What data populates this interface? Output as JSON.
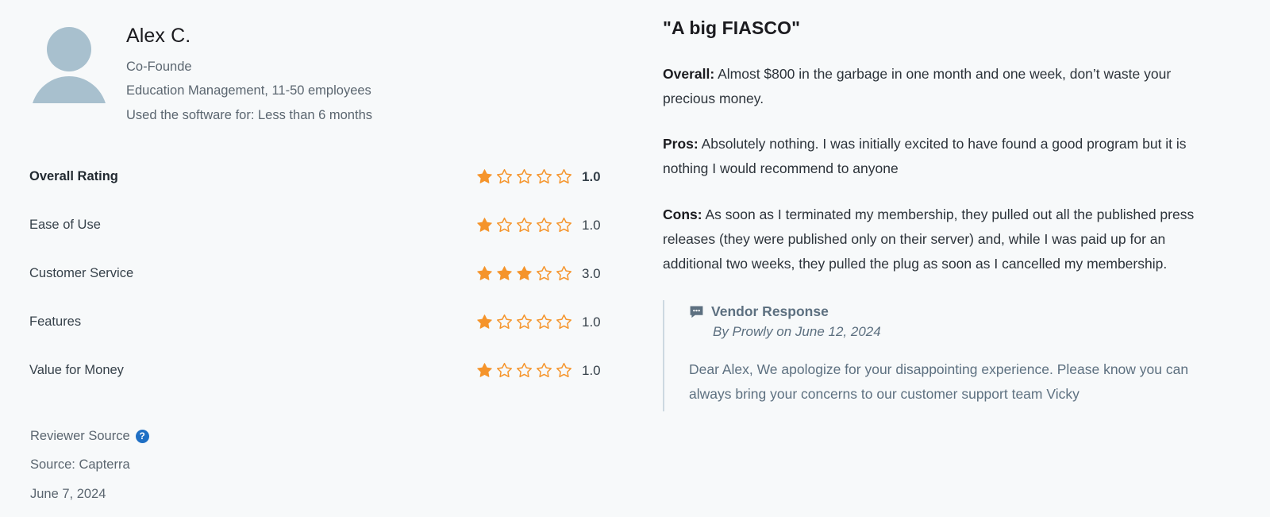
{
  "reviewer": {
    "name": "Alex C.",
    "avatar_icon": "user-avatar-placeholder-icon",
    "job_title": "Co-Founde",
    "industry_line": "Education Management, 11-50 employees",
    "usage_line": "Used the software for: Less than 6 months"
  },
  "ratings": {
    "rows": [
      {
        "label": "Overall Rating",
        "value": "1.0",
        "stars": 1,
        "max": 5,
        "primary": true
      },
      {
        "label": "Ease of Use",
        "value": "1.0",
        "stars": 1,
        "max": 5,
        "primary": false
      },
      {
        "label": "Customer Service",
        "value": "3.0",
        "stars": 3,
        "max": 5,
        "primary": false
      },
      {
        "label": "Features",
        "value": "1.0",
        "stars": 1,
        "max": 5,
        "primary": false
      },
      {
        "label": "Value for Money",
        "value": "1.0",
        "stars": 1,
        "max": 5,
        "primary": false
      }
    ],
    "star_filled_color": "#f5942b",
    "star_empty_color": "#f5942b"
  },
  "source": {
    "reviewer_source_label": "Reviewer Source",
    "help_icon": "help-question-icon",
    "help_icon_glyph": "?",
    "help_icon_color": "#1f6fc4",
    "source_label": "Source: Capterra",
    "review_date": "June 7, 2024"
  },
  "review": {
    "title": "\"A big FIASCO\"",
    "overall_label": "Overall:",
    "overall_text": " Almost $800 in the garbage in one month and one week, don’t waste your precious money.",
    "pros_label": "Pros:",
    "pros_text": " Absolutely nothing. I was initially excited to have found a good program but it is nothing I would recommend to anyone",
    "cons_label": "Cons:",
    "cons_text": " As soon as I terminated my membership, they pulled out all the published press releases (they were published only on their server) and, while I was paid up for an additional two weeks, they pulled the plug as soon as I cancelled my membership."
  },
  "vendor_response": {
    "icon": "chat-bubble-icon",
    "title": "Vendor Response",
    "byline": "By Prowly on June 12, 2024",
    "body": "Dear Alex, We apologize for your disappointing experience. Please know you can always bring your concerns to our customer support team Vicky",
    "accent_color": "#5d7080",
    "rule_color": "#cdd9e1"
  }
}
